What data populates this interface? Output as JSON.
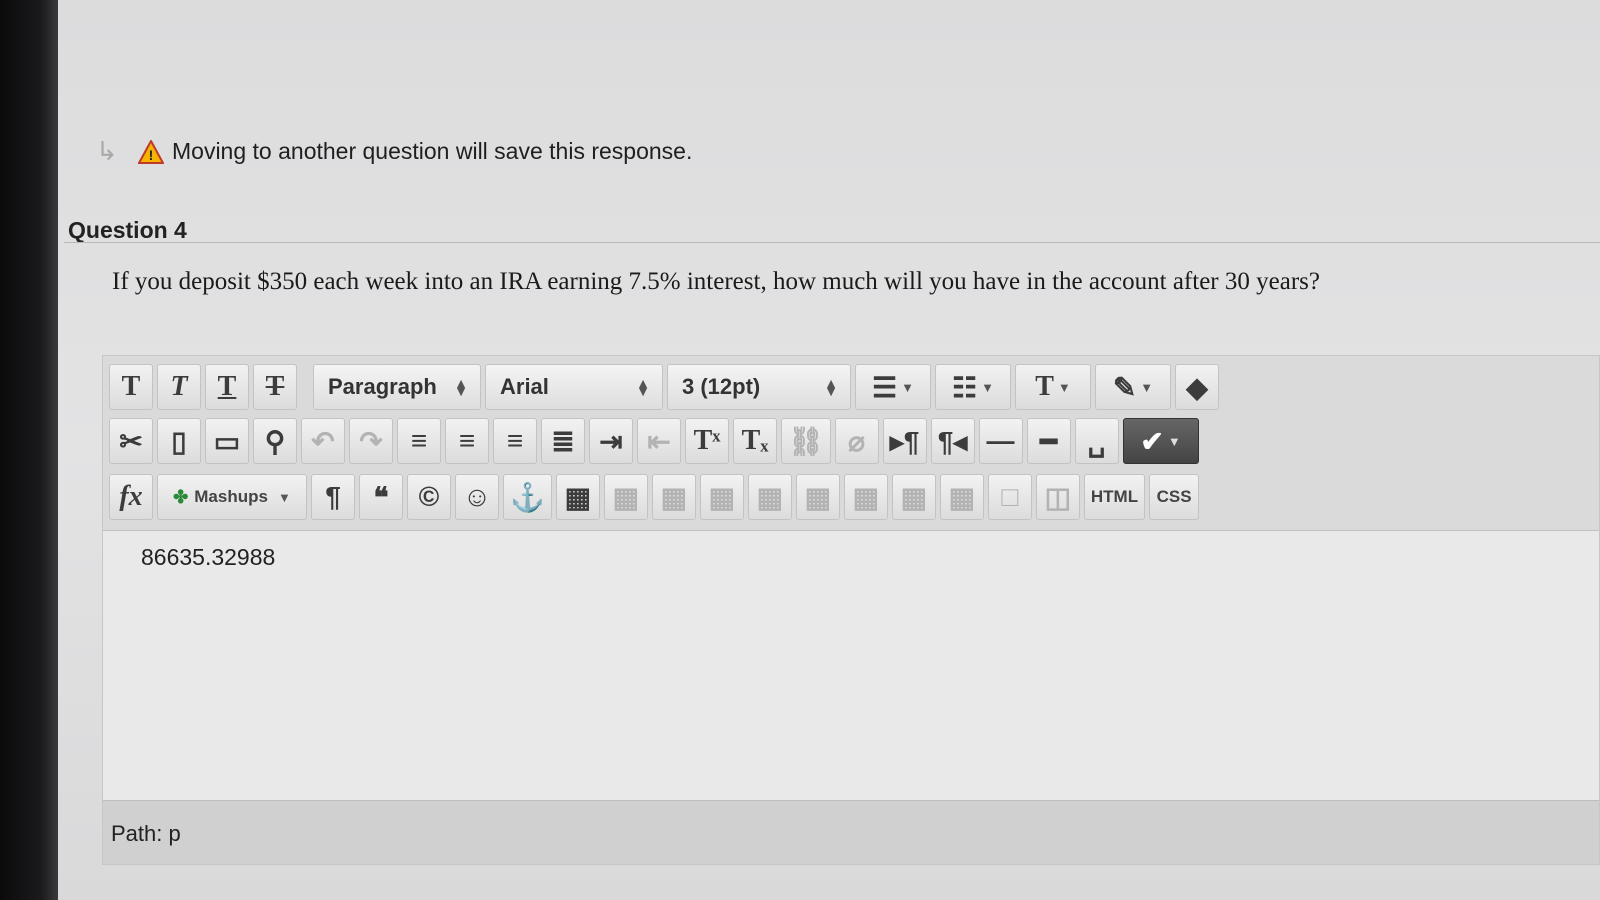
{
  "notice": {
    "text": "Moving to another question will save this response."
  },
  "question": {
    "title": "Question 4",
    "prompt": "If you deposit $350 each week into an IRA earning 7.5% interest, how much will you have in the account after 30 years?"
  },
  "toolbar": {
    "format_select": "Paragraph",
    "font_select": "Arial",
    "size_select": "3 (12pt)",
    "mashups_label": "Mashups",
    "html_label": "HTML",
    "css_label": "CSS",
    "bold_glyph": "T",
    "italic_glyph": "T",
    "underline_glyph": "T",
    "strike_glyph": "T",
    "text_color_glyph": "T",
    "superscript_glyph": "Tˣ",
    "subscript_glyph": "Tₓ",
    "fx_glyph": "fx"
  },
  "editor": {
    "content": "86635.32988"
  },
  "status": {
    "path": "Path: p"
  }
}
